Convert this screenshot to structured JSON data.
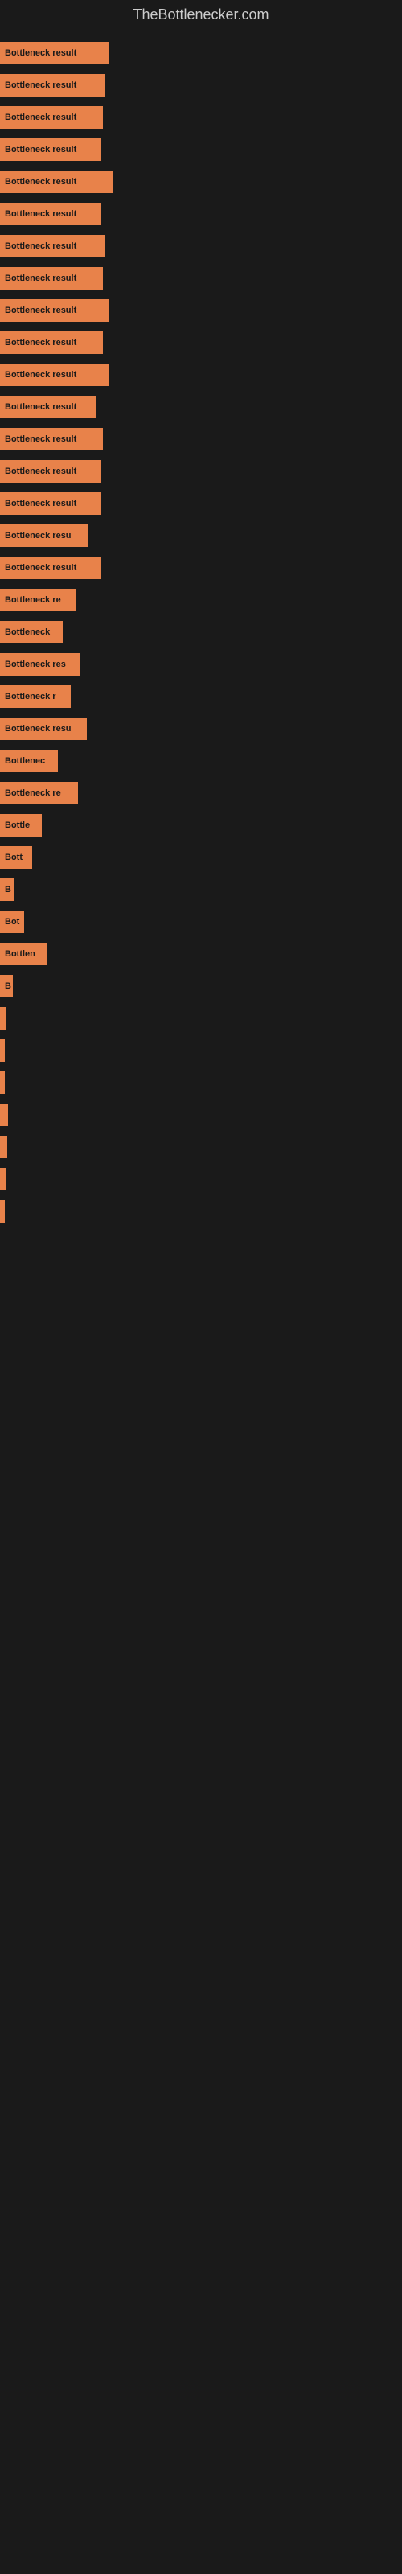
{
  "site": {
    "title": "TheBottlenecker.com"
  },
  "bars": [
    {
      "label": "Bottleneck result",
      "width": 135
    },
    {
      "label": "Bottleneck result",
      "width": 130
    },
    {
      "label": "Bottleneck result",
      "width": 128
    },
    {
      "label": "Bottleneck result",
      "width": 125
    },
    {
      "label": "Bottleneck result",
      "width": 140
    },
    {
      "label": "Bottleneck result",
      "width": 125
    },
    {
      "label": "Bottleneck result",
      "width": 130
    },
    {
      "label": "Bottleneck result",
      "width": 128
    },
    {
      "label": "Bottleneck result",
      "width": 135
    },
    {
      "label": "Bottleneck result",
      "width": 128
    },
    {
      "label": "Bottleneck result",
      "width": 135
    },
    {
      "label": "Bottleneck result",
      "width": 120
    },
    {
      "label": "Bottleneck result",
      "width": 128
    },
    {
      "label": "Bottleneck result",
      "width": 125
    },
    {
      "label": "Bottleneck result",
      "width": 125
    },
    {
      "label": "Bottleneck resu",
      "width": 110
    },
    {
      "label": "Bottleneck result",
      "width": 125
    },
    {
      "label": "Bottleneck re",
      "width": 95
    },
    {
      "label": "Bottleneck",
      "width": 78
    },
    {
      "label": "Bottleneck res",
      "width": 100
    },
    {
      "label": "Bottleneck r",
      "width": 88
    },
    {
      "label": "Bottleneck resu",
      "width": 108
    },
    {
      "label": "Bottlenec",
      "width": 72
    },
    {
      "label": "Bottleneck re",
      "width": 97
    },
    {
      "label": "Bottle",
      "width": 52
    },
    {
      "label": "Bott",
      "width": 40
    },
    {
      "label": "B",
      "width": 18
    },
    {
      "label": "Bot",
      "width": 30
    },
    {
      "label": "Bottlen",
      "width": 58
    },
    {
      "label": "B",
      "width": 16
    },
    {
      "label": "",
      "width": 8
    },
    {
      "label": "",
      "width": 6
    },
    {
      "label": "|",
      "width": 5
    },
    {
      "label": "",
      "width": 10
    },
    {
      "label": "",
      "width": 9
    },
    {
      "label": "",
      "width": 7
    },
    {
      "label": "",
      "width": 5
    }
  ]
}
